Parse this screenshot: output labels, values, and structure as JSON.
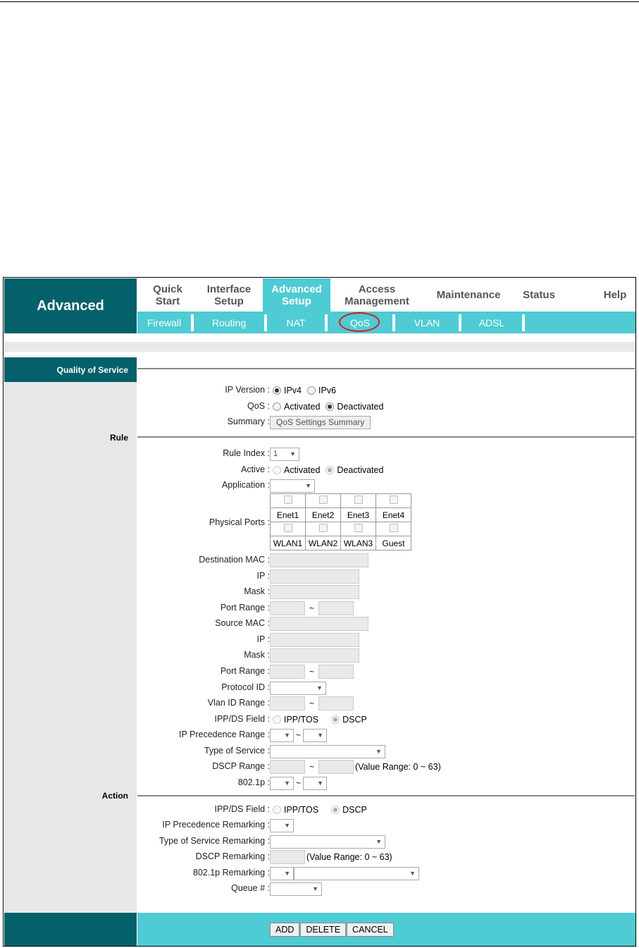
{
  "brand": "Advanced",
  "nav": [
    {
      "label": "Quick\nStart"
    },
    {
      "label": "Interface\nSetup"
    },
    {
      "label": "Advanced\nSetup"
    },
    {
      "label": "Access\nManagement"
    },
    {
      "label": "Maintenance"
    },
    {
      "label": "Status"
    },
    {
      "label": "Help"
    }
  ],
  "subnav": [
    {
      "label": "Firewall"
    },
    {
      "label": "Routing"
    },
    {
      "label": "NAT"
    },
    {
      "label": "QoS"
    },
    {
      "label": "VLAN"
    },
    {
      "label": "ADSL"
    }
  ],
  "section_title": "Quality of Service",
  "sections": {
    "rule": "Rule",
    "action": "Action"
  },
  "qos": {
    "ip_version_label": "IP Version :",
    "ipv4": "IPv4",
    "ipv6": "IPv6",
    "qos_label": "QoS :",
    "activated": "Activated",
    "deactivated": "Deactivated",
    "summary_label": "Summary :",
    "summary_button": "QoS Settings Summary"
  },
  "rule": {
    "rule_index_label": "Rule Index :",
    "rule_index_value": "1",
    "active_label": "Active :",
    "activated": "Activated",
    "deactivated": "Deactivated",
    "application_label": "Application :",
    "physical_ports_label": "Physical Ports :",
    "ports_row1": [
      "Enet1",
      "Enet2",
      "Enet3",
      "Enet4"
    ],
    "ports_row2": [
      "WLAN1",
      "WLAN2",
      "WLAN3",
      "Guest"
    ],
    "dest_mac_label": "Destination MAC :",
    "ip_label": "IP :",
    "mask_label": "Mask :",
    "port_range_label": "Port Range :",
    "src_mac_label": "Source MAC :",
    "protocol_id_label": "Protocol ID :",
    "vlan_id_range_label": "Vlan ID Range :",
    "ippds_field_label": "IPP/DS Field :",
    "ipp_tos": "IPP/TOS",
    "dscp": "DSCP",
    "ip_prec_range_label": "IP Precedence Range :",
    "tos_label": "Type of Service :",
    "dscp_range_label": "DSCP Range :",
    "value_range_note": "(Value Range: 0 ~ 63)",
    "dot1p_label": "802.1p :",
    "tilde": "~"
  },
  "action": {
    "ippds_field_label": "IPP/DS Field :",
    "ipp_tos": "IPP/TOS",
    "dscp": "DSCP",
    "ip_prec_remark_label": "IP Precedence Remarking :",
    "tos_remark_label": "Type of Service Remarking :",
    "dscp_remark_label": "DSCP Remarking :",
    "value_range_note": "(Value Range: 0 ~ 63)",
    "dot1p_remark_label": "802.1p Remarking :",
    "queue_label": "Queue # :"
  },
  "buttons": {
    "add": "ADD",
    "delete": "DELETE",
    "cancel": "CANCEL"
  },
  "arrow": "▼"
}
